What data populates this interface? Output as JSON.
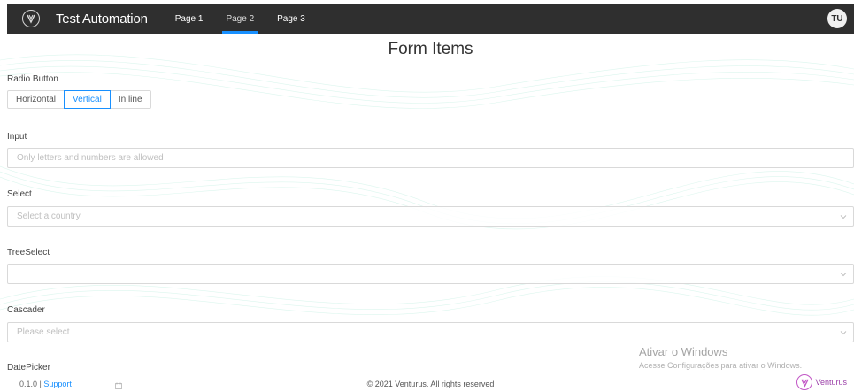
{
  "header": {
    "app_title": "Test Automation",
    "tabs": [
      {
        "label": "Page 1"
      },
      {
        "label": "Page 2"
      },
      {
        "label": "Page 3"
      }
    ],
    "active_tab": "Page 2",
    "avatar_initials": "TU"
  },
  "page": {
    "title": "Form Items"
  },
  "form": {
    "radio": {
      "label": "Radio Button",
      "options": [
        "Horizontal",
        "Vertical",
        "In line"
      ],
      "selected": "Vertical"
    },
    "input": {
      "label": "Input",
      "placeholder": "Only letters and numbers are allowed",
      "value": ""
    },
    "select": {
      "label": "Select",
      "placeholder": "Select a country"
    },
    "treeselect": {
      "label": "TreeSelect",
      "placeholder": ""
    },
    "cascader": {
      "label": "Cascader",
      "placeholder": "Please select"
    },
    "datepicker": {
      "label": "DatePicker"
    }
  },
  "footer": {
    "version": "0.1.0 |",
    "support_label": "Support",
    "copyright": "© 2021 Venturus. All rights reserved",
    "brand": "Venturus"
  },
  "os_watermark": {
    "title": "Ativar o Windows",
    "subtitle": "Acesse Configurações para ativar o Windows."
  },
  "colors": {
    "header_bg": "#2f2f2f",
    "accent": "#1890ff",
    "brand": "#9b3fa8"
  },
  "icons": [
    "venturus-logo-icon",
    "chevron-down-icon",
    "calendar-icon"
  ]
}
